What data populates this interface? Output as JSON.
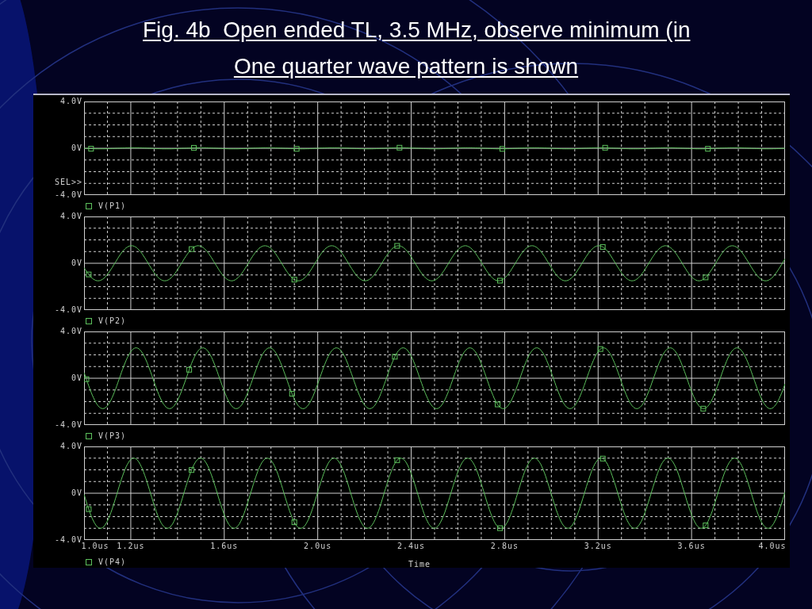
{
  "slide": {
    "title_lines": [
      "Fig. 4b  Open ended TL, 3.5 MHz, observe minimum (in",
      "One quarter wave pattern is shown"
    ]
  },
  "plot_window": {
    "panels": [
      {
        "y_top": "4.0V",
        "y_mid": "0V",
        "y_bottom": "-4.0V",
        "selector": "SEL>>",
        "trace": "V(P1)",
        "color": "#5cc05c"
      },
      {
        "y_top": "4.0V",
        "y_mid": "0V",
        "y_bottom": "-4.0V",
        "trace": "V(P2)",
        "color": "#5cc05c"
      },
      {
        "y_top": "4.0V",
        "y_mid": "0V",
        "y_bottom": "-4.0V",
        "trace": "V(P3)",
        "color": "#5cc05c"
      },
      {
        "y_top": "4.0V",
        "y_mid": "0V",
        "y_bottom": "-4.0V",
        "trace": "V(P4)",
        "color": "#5cc05c"
      }
    ],
    "x_ticks": [
      "1.0us",
      "1.2us",
      "1.6us",
      "2.0us",
      "2.4us",
      "2.8us",
      "3.2us",
      "3.6us",
      "4.0us"
    ],
    "x_label": "Time"
  }
}
